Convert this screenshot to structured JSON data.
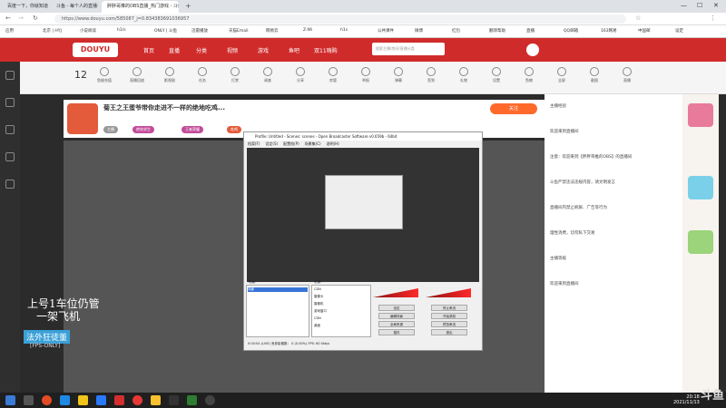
{
  "browser": {
    "tabs": [
      {
        "label": "百度一下，你就知道",
        "active": false
      },
      {
        "label": "斗鱼 - 每个人的直播平台",
        "active": false
      },
      {
        "label": "胖胖哥推的OBS直播_热门游戏 - 斗鱼",
        "active": true
      }
    ],
    "url": "https://www.douyu.com/585087_j=0.834383691036957",
    "bookmarks": [
      "应用",
      "北京 | HYJ",
      "小说阅读",
      "h1/s",
      "ONLY | 斗鱼",
      "迅雷播放",
      "天猫Email",
      "网易云",
      "Z-Wi",
      "h1s",
      "公共课件",
      "微博",
      "红包",
      "翻译帮助",
      "直播",
      "QQ邮箱",
      "163网易",
      "中国邮",
      "设定"
    ]
  },
  "site": {
    "nav": [
      "首页",
      "直播",
      "分类",
      "视频",
      "游戏",
      "鱼吧",
      "双11嗨购"
    ],
    "search_placeholder": "搜索主播/房间/直播分类"
  },
  "toolbar": {
    "count": "12",
    "tools": [
      "鱼翅充值",
      "直播回放",
      "影视剧",
      "任务",
      "打赏",
      "调查",
      "分享",
      "房管",
      "举报",
      "弹幕",
      "签到",
      "礼物",
      "设置",
      "鱼粮",
      "全屏",
      "截图",
      "直播"
    ]
  },
  "room": {
    "title": "菊王之王蛋爷带你走进不一样的绝地吃鸡...",
    "tags": [
      "主播",
      "绝地求生",
      "王者荣耀",
      "吃鸡"
    ],
    "follow_label": "关注"
  },
  "obs": {
    "title": "Profile: Untitled - Scenes: scenes - Open Broadcaster Software v0.659b - 64bit",
    "menu": [
      "档案(F)",
      "设定(S)",
      "配置档(P)",
      "场景集(C)",
      "说明(H)"
    ],
    "scenes_label": "场景：",
    "scenes": [
      "场景"
    ],
    "sources_label": "来源：",
    "sources": [
      "CDN",
      "摄像头",
      "摄像机",
      "游戏窗口",
      "CDN",
      "桌面"
    ],
    "buttons": [
      "设定",
      "停止串流",
      "编辑场景",
      "开始录制",
      "全局来源",
      "预览串流",
      "插件",
      "退出"
    ],
    "status": "0:00:04 (LIVE)   丢弃影格数： 0 (0.00%)   FPS: 60   0kb/s"
  },
  "overlay": {
    "line1": "上号1车位仍管",
    "line1b": "一架飞机",
    "line2": "法外狂徒董",
    "line3": "[FPS-ONLY]"
  },
  "chat": [
    "主播经验",
    "欢迎来到直播间",
    "注意：欢迎来到【胖胖哥推的OBS】的直播间",
    "斗鱼严禁违法违规内容，请文明发言",
    "直播间内禁止刷屏、广告等行为",
    "理性消费，切勿私下交易",
    "主播等级",
    "欢迎来到直播间"
  ],
  "taskbar": {
    "time": "20:18",
    "date": "2021/11/13"
  },
  "watermark": "斗鱼"
}
